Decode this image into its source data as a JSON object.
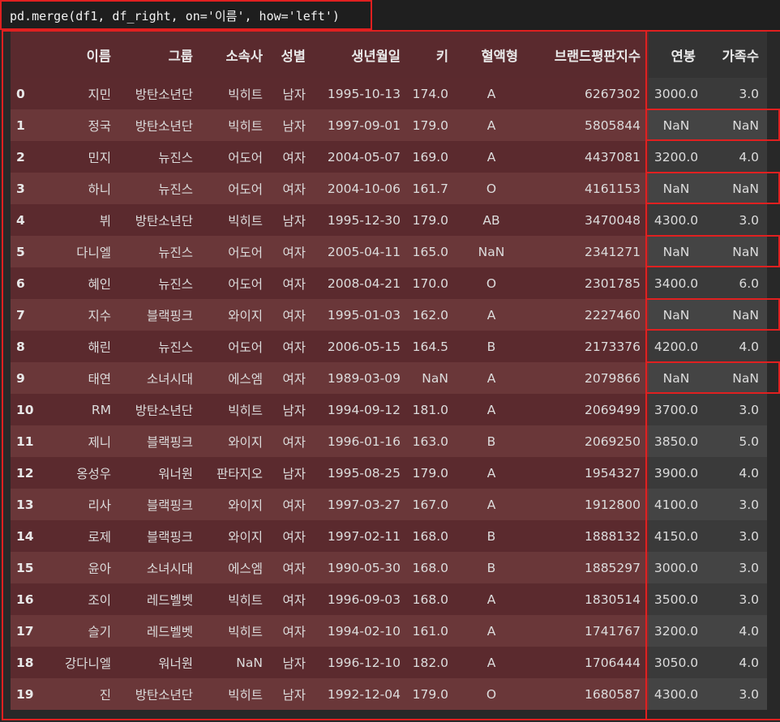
{
  "code": "pd.merge(df1, df_right, on='이름', how='left')",
  "columns": [
    "",
    "이름",
    "그룹",
    "소속사",
    "성별",
    "생년월일",
    "키",
    "혈액형",
    "브랜드평판지수",
    "연봉",
    "가족수"
  ],
  "rows": [
    [
      "0",
      "지민",
      "방탄소년단",
      "빅히트",
      "남자",
      "1995-10-13",
      "174.0",
      "A",
      "6267302",
      "3000.0",
      "3.0"
    ],
    [
      "1",
      "정국",
      "방탄소년단",
      "빅히트",
      "남자",
      "1997-09-01",
      "179.0",
      "A",
      "5805844",
      "NaN",
      "NaN"
    ],
    [
      "2",
      "민지",
      "뉴진스",
      "어도어",
      "여자",
      "2004-05-07",
      "169.0",
      "A",
      "4437081",
      "3200.0",
      "4.0"
    ],
    [
      "3",
      "하니",
      "뉴진스",
      "어도어",
      "여자",
      "2004-10-06",
      "161.7",
      "O",
      "4161153",
      "NaN",
      "NaN"
    ],
    [
      "4",
      "뷔",
      "방탄소년단",
      "빅히트",
      "남자",
      "1995-12-30",
      "179.0",
      "AB",
      "3470048",
      "4300.0",
      "3.0"
    ],
    [
      "5",
      "다니엘",
      "뉴진스",
      "어도어",
      "여자",
      "2005-04-11",
      "165.0",
      "NaN",
      "2341271",
      "NaN",
      "NaN"
    ],
    [
      "6",
      "혜인",
      "뉴진스",
      "어도어",
      "여자",
      "2008-04-21",
      "170.0",
      "O",
      "2301785",
      "3400.0",
      "6.0"
    ],
    [
      "7",
      "지수",
      "블랙핑크",
      "와이지",
      "여자",
      "1995-01-03",
      "162.0",
      "A",
      "2227460",
      "NaN",
      "NaN"
    ],
    [
      "8",
      "해린",
      "뉴진스",
      "어도어",
      "여자",
      "2006-05-15",
      "164.5",
      "B",
      "2173376",
      "4200.0",
      "4.0"
    ],
    [
      "9",
      "태연",
      "소녀시대",
      "에스엠",
      "여자",
      "1989-03-09",
      "NaN",
      "A",
      "2079866",
      "NaN",
      "NaN"
    ],
    [
      "10",
      "RM",
      "방탄소년단",
      "빅히트",
      "남자",
      "1994-09-12",
      "181.0",
      "A",
      "2069499",
      "3700.0",
      "3.0"
    ],
    [
      "11",
      "제니",
      "블랙핑크",
      "와이지",
      "여자",
      "1996-01-16",
      "163.0",
      "B",
      "2069250",
      "3850.0",
      "5.0"
    ],
    [
      "12",
      "옹성우",
      "워너원",
      "판타지오",
      "남자",
      "1995-08-25",
      "179.0",
      "A",
      "1954327",
      "3900.0",
      "4.0"
    ],
    [
      "13",
      "리사",
      "블랙핑크",
      "와이지",
      "여자",
      "1997-03-27",
      "167.0",
      "A",
      "1912800",
      "4100.0",
      "3.0"
    ],
    [
      "14",
      "로제",
      "블랙핑크",
      "와이지",
      "여자",
      "1997-02-11",
      "168.0",
      "B",
      "1888132",
      "4150.0",
      "3.0"
    ],
    [
      "15",
      "윤아",
      "소녀시대",
      "에스엠",
      "여자",
      "1990-05-30",
      "168.0",
      "B",
      "1885297",
      "3000.0",
      "3.0"
    ],
    [
      "16",
      "조이",
      "레드벨벳",
      "빅히트",
      "여자",
      "1996-09-03",
      "168.0",
      "A",
      "1830514",
      "3500.0",
      "3.0"
    ],
    [
      "17",
      "슬기",
      "레드벨벳",
      "빅히트",
      "여자",
      "1994-02-10",
      "161.0",
      "A",
      "1741767",
      "3200.0",
      "4.0"
    ],
    [
      "18",
      "강다니엘",
      "워너원",
      "NaN",
      "남자",
      "1996-12-10",
      "182.0",
      "A",
      "1706444",
      "3050.0",
      "4.0"
    ],
    [
      "19",
      "진",
      "방탄소년단",
      "빅히트",
      "남자",
      "1992-12-04",
      "179.0",
      "O",
      "1680587",
      "4300.0",
      "3.0"
    ]
  ],
  "colors": {
    "highlight_border": "#e02020",
    "left_row_dark": "#5b2a2e",
    "left_row_light": "#6a3739",
    "right_row_dark": "#3a3a3a",
    "right_row_light": "#444444"
  }
}
